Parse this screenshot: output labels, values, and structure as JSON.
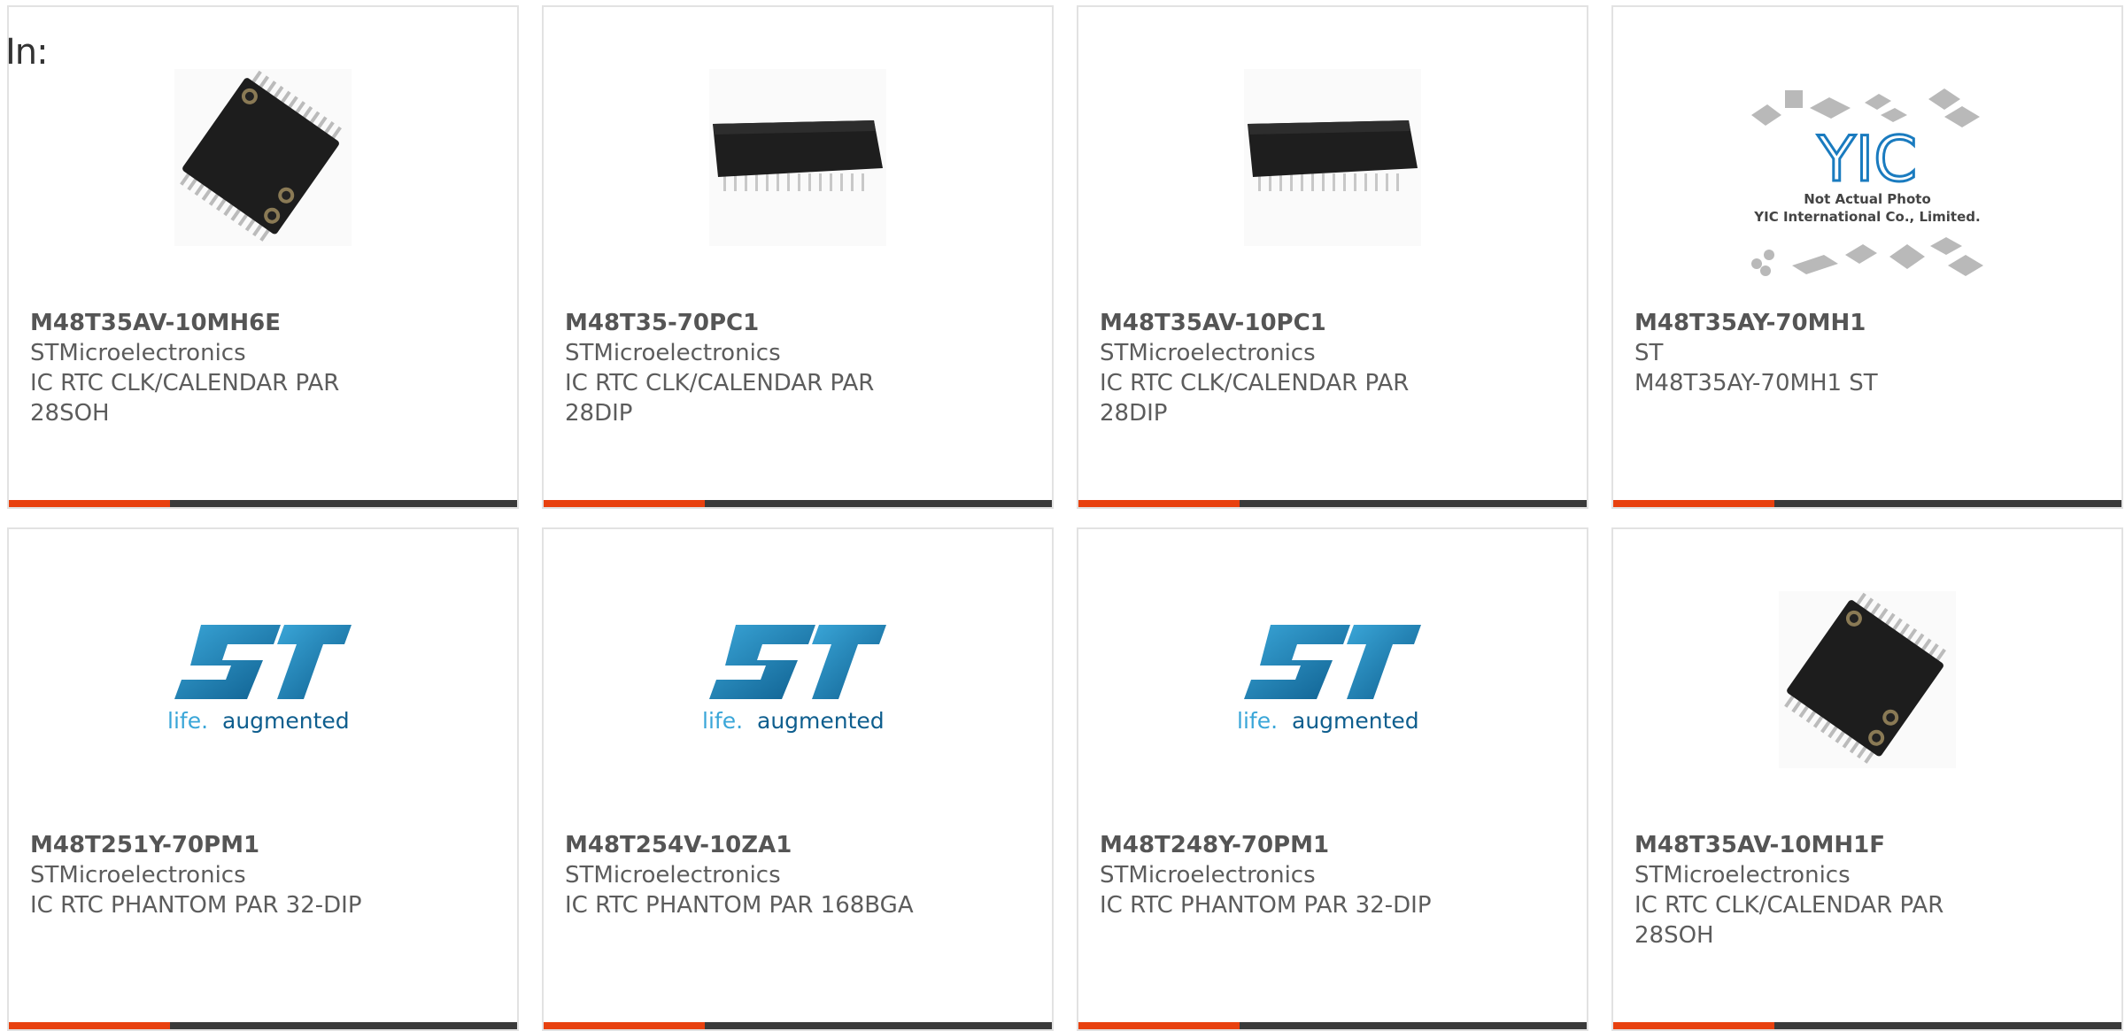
{
  "header": {
    "in_label": "In:"
  },
  "products": [
    {
      "part": "M48T35AV-10MH6E",
      "maker": "STMicroelectronics",
      "desc1": "IC RTC CLK/CALENDAR PAR",
      "desc2": "28SOH",
      "image": "soic-chip"
    },
    {
      "part": "M48T35-70PC1",
      "maker": "STMicroelectronics",
      "desc1": "IC RTC CLK/CALENDAR PAR",
      "desc2": "28DIP",
      "image": "dip-chip"
    },
    {
      "part": "M48T35AV-10PC1",
      "maker": "STMicroelectronics",
      "desc1": "IC RTC CLK/CALENDAR PAR",
      "desc2": "28DIP",
      "image": "dip-chip"
    },
    {
      "part": "M48T35AY-70MH1",
      "maker": "ST",
      "desc1": "M48T35AY-70MH1 ST",
      "desc2": "",
      "image": "yic-placeholder",
      "placeholder_text1": "Not Actual Photo",
      "placeholder_text2": "YIC International Co., Limited.",
      "placeholder_logo": "YIC"
    },
    {
      "part": "M48T251Y-70PM1",
      "maker": "STMicroelectronics",
      "desc1": "IC RTC PHANTOM PAR 32-DIP",
      "desc2": "",
      "image": "st-logo"
    },
    {
      "part": "M48T254V-10ZA1",
      "maker": "STMicroelectronics",
      "desc1": "IC RTC PHANTOM PAR 168BGA",
      "desc2": "",
      "image": "st-logo"
    },
    {
      "part": "M48T248Y-70PM1",
      "maker": "STMicroelectronics",
      "desc1": "IC RTC PHANTOM PAR 32-DIP",
      "desc2": "",
      "image": "st-logo"
    },
    {
      "part": "M48T35AV-10MH1F",
      "maker": "STMicroelectronics",
      "desc1": "IC RTC CLK/CALENDAR PAR",
      "desc2": "28SOH",
      "image": "soic-chip"
    }
  ],
  "st_logo": {
    "mark": "ST",
    "tagline_life": "life.",
    "tagline_aug": "augmented"
  },
  "colors": {
    "accent": "#e8410f",
    "bar": "#3a3a3a",
    "st_blue": "#1a8dc4"
  }
}
